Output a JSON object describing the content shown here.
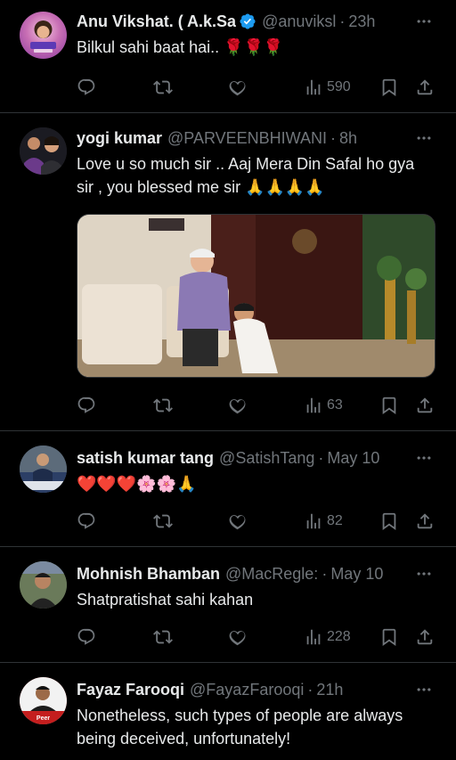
{
  "tweets": [
    {
      "name": "Anu Vikshat. ( A.k.Sa",
      "handle": "@anuviksl",
      "time": "23h",
      "text": "Bilkul sahi baat hai.. 🌹🌹🌹",
      "views": "590",
      "verified": true
    },
    {
      "name": "yogi kumar",
      "handle": "@PARVEENBHIWANI",
      "time": "8h",
      "text": "Love u so much  sir .. Aaj Mera Din Safal ho gya sir ,  you blessed me  sir  🙏🙏🙏🙏",
      "views": "63"
    },
    {
      "name": "satish kumar tang",
      "handle": "@SatishTang",
      "time": "May 10",
      "text": "❤️❤️❤️🌸🌸🙏",
      "views": "82"
    },
    {
      "name": "Mohnish Bhamban",
      "handle": "@MacRegle:",
      "time": "May 10",
      "text": "Shatpratishat sahi kahan",
      "views": "228"
    },
    {
      "name": "Fayaz Farooqi",
      "handle": "@FayazFarooqi",
      "time": "21h",
      "text": "Nonetheless, such types of people are always being deceived, unfortunately!",
      "avatar_label": "Peer"
    }
  ],
  "colors": {
    "background": "#000000",
    "text": "#e7e9ea",
    "muted": "#71767b",
    "divider": "#2f3336",
    "verified": "#1d9bf0"
  },
  "icons": [
    "reply-icon",
    "retweet-icon",
    "like-icon",
    "views-icon",
    "bookmark-icon",
    "share-icon",
    "more-icon",
    "verified-icon"
  ]
}
